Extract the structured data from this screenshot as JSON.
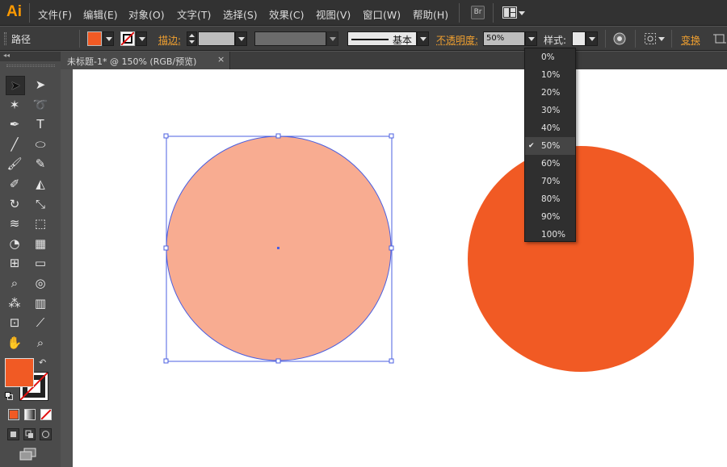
{
  "app": {
    "logo": "Ai"
  },
  "menu": {
    "items": [
      "文件(F)",
      "编辑(E)",
      "对象(O)",
      "文字(T)",
      "选择(S)",
      "效果(C)",
      "视图(V)",
      "窗口(W)",
      "帮助(H)"
    ],
    "bridge_label": "Br"
  },
  "control_bar": {
    "selection_type": "路径",
    "stroke_label": "描边:",
    "stroke_profile": "基本",
    "opacity_label": "不透明度:",
    "opacity_value": "50%",
    "style_label": "样式:",
    "transform_label": "变换",
    "fill_color": "#f15a24"
  },
  "document": {
    "tab_title": "未标题-1* @ 150% (RGB/预览)",
    "close_glyph": "×"
  },
  "opacity_menu": {
    "options": [
      "0%",
      "10%",
      "20%",
      "30%",
      "40%",
      "50%",
      "60%",
      "70%",
      "80%",
      "90%",
      "100%"
    ],
    "selected": "50%",
    "check_glyph": "✔"
  },
  "artwork": {
    "circle_color": "#f15a24",
    "selected_opacity": "50%",
    "selection_color": "#4b5fe0"
  },
  "tools": {
    "fill_color": "#f15a24",
    "icons": [
      "selection-tool",
      "direct-selection-tool",
      "magic-wand-tool",
      "lasso-tool",
      "pen-tool",
      "type-tool",
      "line-tool",
      "ellipse-tool",
      "paintbrush-tool",
      "pencil-tool",
      "blob-brush-tool",
      "eraser-tool",
      "rotate-tool",
      "scale-tool",
      "warp-tool",
      "free-transform-tool",
      "shape-builder-tool",
      "perspective-grid-tool",
      "mesh-tool",
      "gradient-tool",
      "eyedropper-tool",
      "blend-tool",
      "symbol-sprayer-tool",
      "graph-tool",
      "artboard-tool",
      "slice-tool",
      "hand-tool",
      "zoom-tool"
    ]
  }
}
